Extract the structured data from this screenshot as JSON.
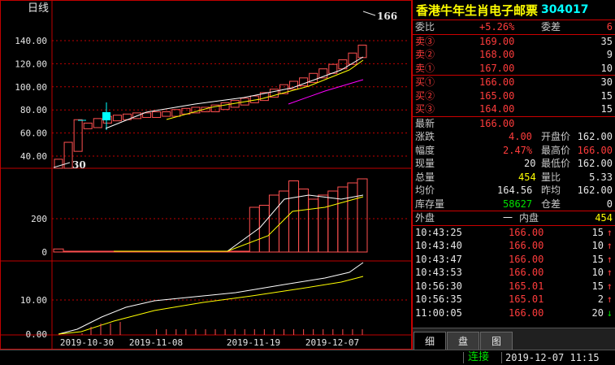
{
  "chart": {
    "period_label": "日线",
    "price_axis": [
      140,
      120,
      100,
      80,
      60,
      40
    ],
    "price_tick_labels": [
      "140.00",
      "120.00",
      "100.00",
      "80.00",
      "60.00",
      "40.00"
    ],
    "high_marker": "166",
    "low_marker": "30",
    "volume_tick_labels": [
      "200",
      "0"
    ],
    "indicator_tick_labels": [
      "10.00",
      "0.00"
    ],
    "date_labels": [
      "2019-10-30",
      "2019-11-08",
      "2019-11-19",
      "2019-12-07"
    ],
    "colors": {
      "up": "#ff5050",
      "ma1": "#ffffff",
      "ma2": "#ffff00",
      "ma3": "#ff00ff",
      "cyan": "#00ffff",
      "grid": "#c00000"
    }
  },
  "chart_data": {
    "type": "candlestick",
    "price_ylim": [
      30,
      166
    ],
    "candles_close": [
      30,
      45,
      65,
      66,
      70,
      72,
      73,
      74,
      75,
      75,
      76,
      76,
      78,
      79,
      80,
      80,
      82,
      84,
      86,
      88,
      90,
      93,
      96,
      100,
      103,
      106,
      110,
      114,
      118,
      122,
      128,
      135
    ],
    "volume": [
      15,
      0,
      0,
      0,
      0,
      0,
      0,
      0,
      0,
      0,
      0,
      0,
      0,
      0,
      0,
      0,
      0,
      0,
      0,
      0,
      220,
      230,
      280,
      300,
      350,
      310,
      260,
      280,
      300,
      320,
      340,
      360
    ]
  },
  "stock": {
    "name": "香港牛年生肖电子邮票",
    "code": "304017"
  },
  "order_book": {
    "wei_bi_label": "委比",
    "wei_bi_value": "+5.26%",
    "wei_cha_label": "委差",
    "wei_cha_value": "6",
    "asks": [
      {
        "label": "卖③",
        "price": "169.00",
        "vol": "35"
      },
      {
        "label": "卖②",
        "price": "168.00",
        "vol": "9"
      },
      {
        "label": "卖①",
        "price": "167.00",
        "vol": "10"
      }
    ],
    "bids": [
      {
        "label": "买①",
        "price": "166.00",
        "vol": "30"
      },
      {
        "label": "买②",
        "price": "165.00",
        "vol": "15"
      },
      {
        "label": "买③",
        "price": "164.00",
        "vol": "15"
      }
    ]
  },
  "quote": {
    "latest_label": "最新",
    "latest": "166.00",
    "change_label": "涨跌",
    "change": "4.00",
    "open_label": "开盘价",
    "open": "162.00",
    "pct_label": "幅度",
    "pct": "2.47%",
    "high_label": "最高价",
    "high": "166.00",
    "cur_vol_label": "现量",
    "cur_vol": "20",
    "low_label": "最低价",
    "low": "162.00",
    "total_vol_label": "总量",
    "total_vol": "454",
    "vol_ratio_label": "量比",
    "vol_ratio": "5.33",
    "avg_label": "均价",
    "avg": "164.56",
    "prev_avg_label": "昨均",
    "prev_avg": "162.00",
    "inventory_label": "库存量",
    "inventory": "58627",
    "pos_diff_label": "仓差",
    "pos_diff": "0",
    "outer_label": "外盘",
    "outer": "一",
    "inner_label": "内盘",
    "inner": "454"
  },
  "ticks": [
    {
      "time": "10:43:25",
      "price": "166.00",
      "vol": "15",
      "dir": "↑"
    },
    {
      "time": "10:43:40",
      "price": "166.00",
      "vol": "10",
      "dir": "↑"
    },
    {
      "time": "10:43:47",
      "price": "166.00",
      "vol": "15",
      "dir": "↑"
    },
    {
      "time": "10:43:53",
      "price": "166.00",
      "vol": "10",
      "dir": "↑"
    },
    {
      "time": "10:56:30",
      "price": "165.01",
      "vol": "15",
      "dir": "↑"
    },
    {
      "time": "10:56:35",
      "price": "165.01",
      "vol": "2",
      "dir": "↑"
    },
    {
      "time": "11:00:05",
      "price": "166.00",
      "vol": "20",
      "dir": "↓"
    }
  ],
  "tabs": [
    "细",
    "盘",
    "图"
  ],
  "status": {
    "connection": "连接",
    "datetime": "2019-12-07  11:15"
  }
}
